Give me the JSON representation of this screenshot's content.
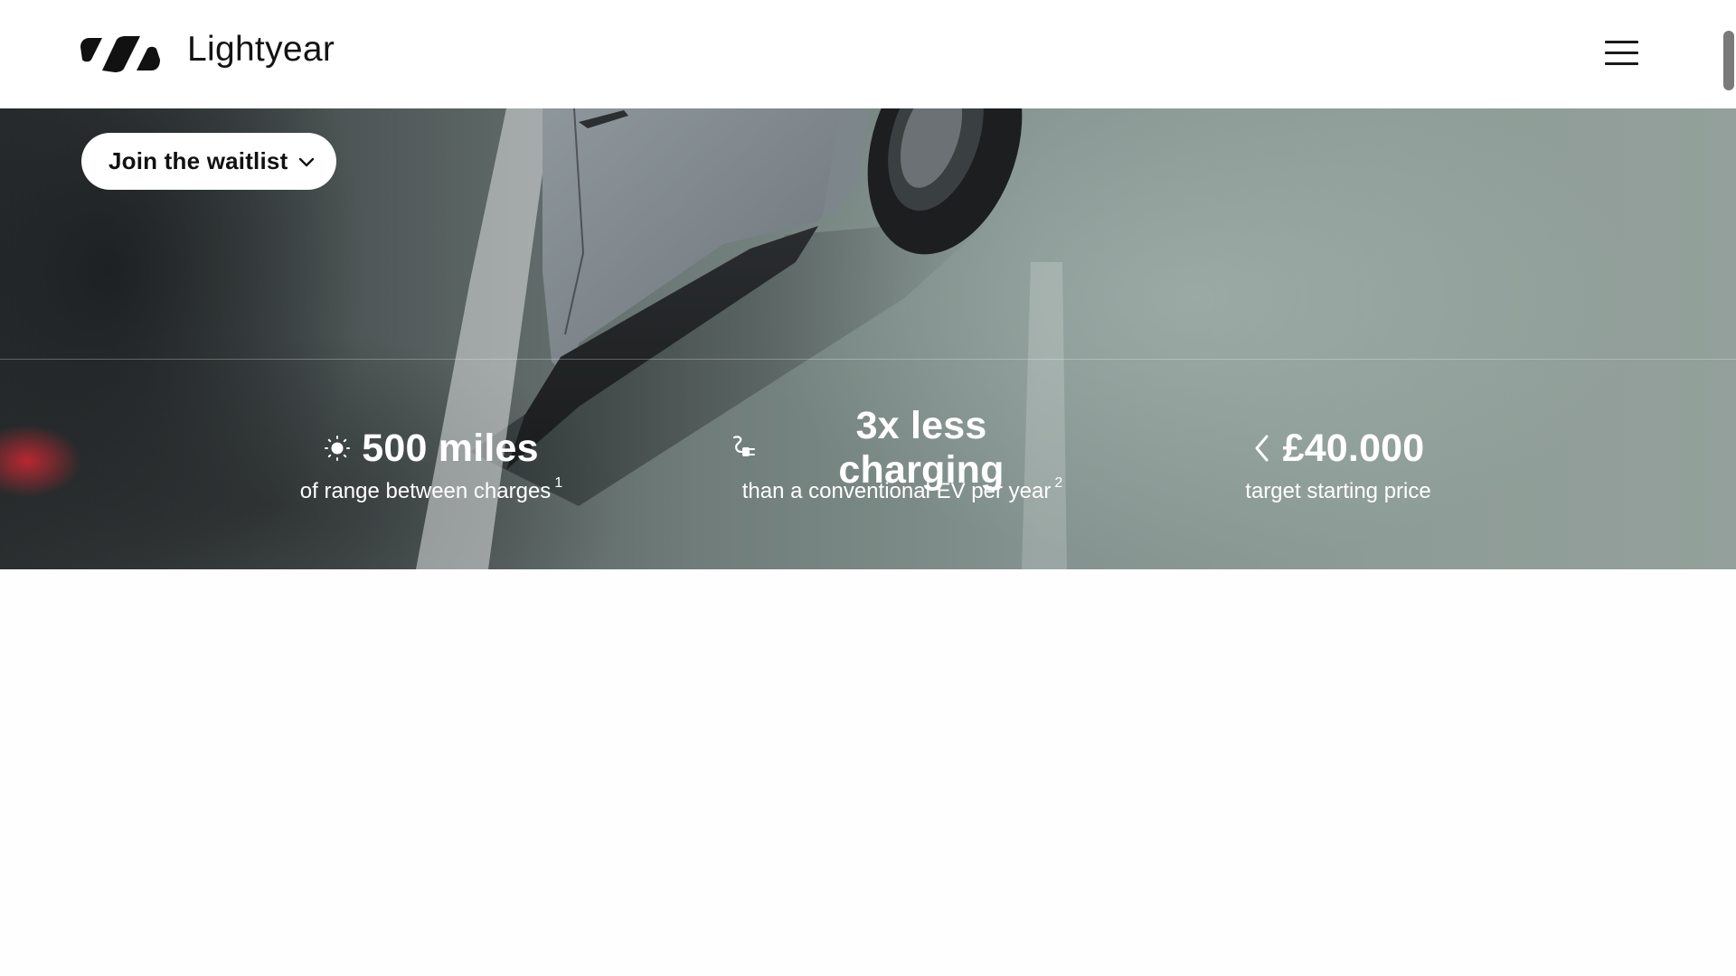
{
  "header": {
    "brand": "Lightyear",
    "logo_icon": "lightyear-logo-icon",
    "menu_icon": "hamburger-menu-icon"
  },
  "hero": {
    "cta_label": "Join the waitlist",
    "cta_icon": "chevron-down-icon"
  },
  "stats": [
    {
      "icon": "sun-icon",
      "value": "500 miles",
      "caption": "of range between charges",
      "footnote": "1"
    },
    {
      "icon": "charging-plug-icon",
      "value": "3x less charging",
      "caption": "than a conventional EV per year",
      "footnote": "2"
    },
    {
      "icon": "chevron-left-icon",
      "value": "£40.000",
      "caption": "target starting price",
      "footnote": ""
    }
  ],
  "colors": {
    "header_bg": "#ffffff",
    "hero_teal": "#8e9c97",
    "text_dark": "#141414",
    "text_light": "#ffffff"
  }
}
